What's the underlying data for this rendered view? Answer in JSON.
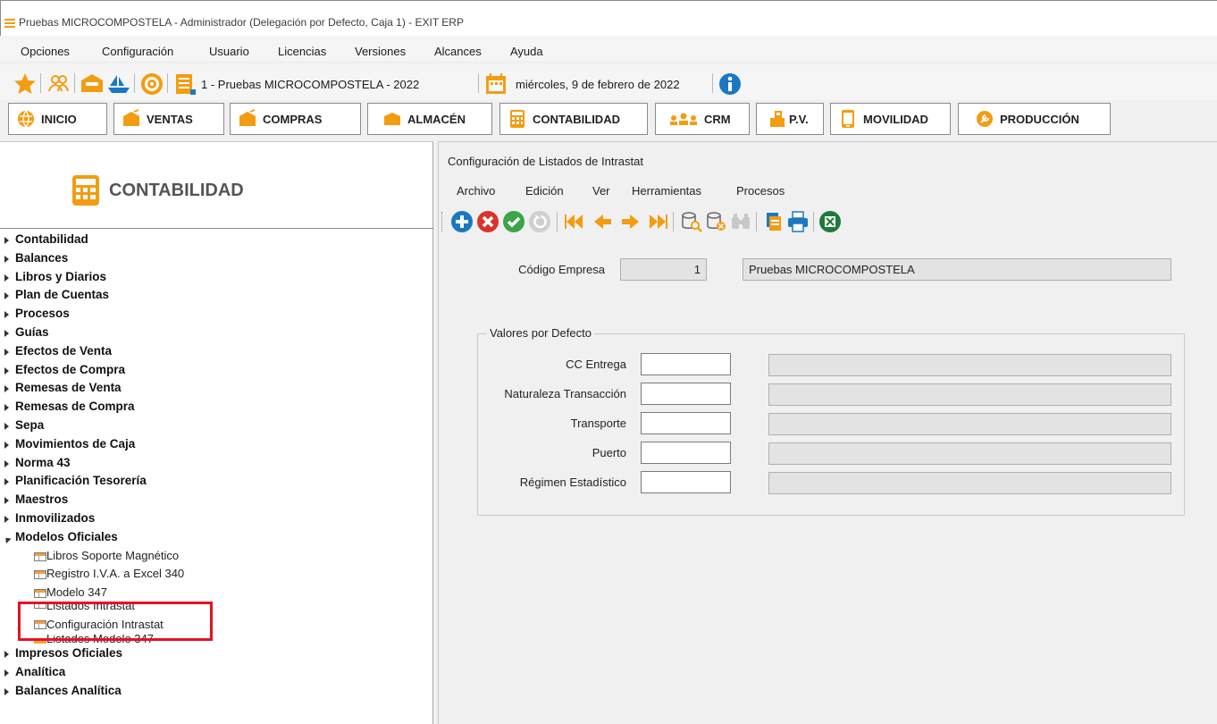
{
  "window": {
    "title": "Pruebas MICROCOMPOSTELA - Administrador (Delegación por Defecto, Caja 1) - EXIT ERP"
  },
  "menubar": {
    "items": [
      "Opciones",
      "Configuración",
      "Usuario",
      "Licencias",
      "Versiones",
      "Alcances",
      "Ayuda"
    ]
  },
  "quickbar": {
    "company": "1 - Pruebas MICROCOMPOSTELA - 2022",
    "date": "miércoles, 9 de febrero de 2022",
    "icons": [
      "star-icon",
      "users-icon",
      "box-icon",
      "ship-icon",
      "disc-icon",
      "bars-icon",
      "calendar-icon",
      "info-icon"
    ]
  },
  "modules": [
    "INICIO",
    "VENTAS",
    "COMPRAS",
    "ALMACÉN",
    "CONTABILIDAD",
    "CRM",
    "P.V.",
    "MOVILIDAD",
    "PRODUCCIÓN"
  ],
  "leftpanel": {
    "module_title": "CONTABILIDAD",
    "tree_top": [
      "Contabilidad",
      "Balances",
      "Libros y Diarios",
      "Plan de Cuentas",
      "Procesos",
      "Guías",
      "Efectos de Venta",
      "Efectos de Compra",
      "Remesas de Venta",
      "Remesas de Compra",
      "Sepa",
      "Movimientos de Caja",
      "Norma 43",
      "Planificación Tesorería",
      "Maestros",
      "Inmovilizados"
    ],
    "expanded": "Modelos Oficiales",
    "leaves": [
      "Libros Soporte Magnético",
      "Registro I.V.A. a Excel 340",
      "Modelo 347",
      "Listados Intrastat",
      "Configuración Intrastat",
      "Listados Modelo 347"
    ],
    "tree_bottom": [
      "Impresos Oficiales",
      "Analítica",
      "Balances Analítica"
    ]
  },
  "content": {
    "window_title": "Configuración de Listados de Intrastat",
    "menu": [
      "Archivo",
      "Edición",
      "Ver",
      "Herramientas",
      "Procesos"
    ],
    "codigo_empresa": {
      "label": "Código Empresa",
      "value": "1",
      "name": "Pruebas MICROCOMPOSTELA"
    },
    "group": {
      "legend": "Valores por Defecto",
      "fields": [
        {
          "label": "CC Entrega",
          "value": "",
          "description": ""
        },
        {
          "label": "Naturaleza Transacción",
          "value": "",
          "description": ""
        },
        {
          "label": "Transporte",
          "value": "",
          "description": ""
        },
        {
          "label": "Puerto",
          "value": "",
          "description": ""
        },
        {
          "label": "Régimen Estadístico",
          "value": "",
          "description": ""
        }
      ]
    }
  },
  "colors": {
    "accent_orange": "#f39c12",
    "highlight_red": "#e81123",
    "blue": "#1a78c2",
    "green": "#3aa54a",
    "red": "#d9342b"
  }
}
